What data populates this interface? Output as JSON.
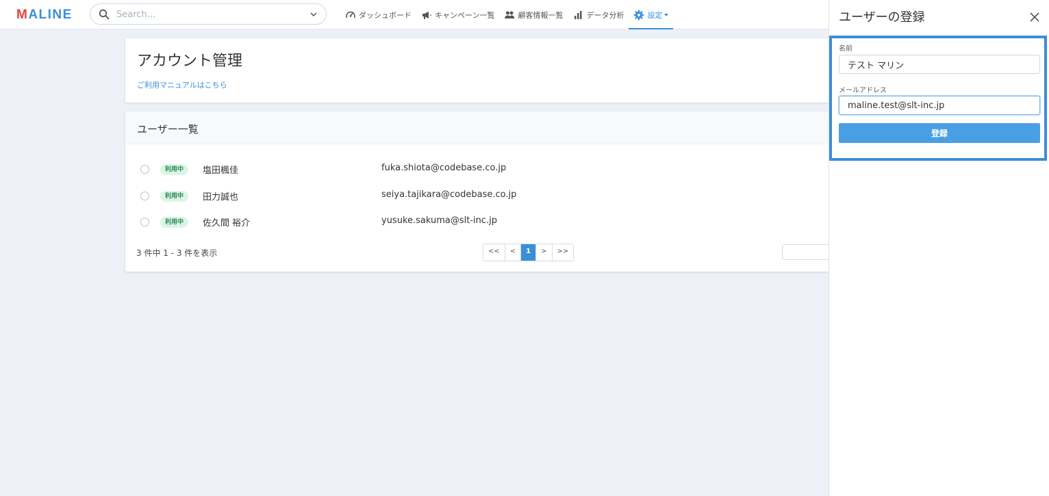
{
  "app": {
    "logo_prefix": "M",
    "logo_rest": "ALINE"
  },
  "search": {
    "placeholder": "Search..."
  },
  "nav": {
    "items": [
      {
        "label": "ダッシュボード",
        "icon": "gauge-icon"
      },
      {
        "label": "キャンペーン一覧",
        "icon": "megaphone-icon"
      },
      {
        "label": "顧客情報一覧",
        "icon": "users-icon"
      },
      {
        "label": "データ分析",
        "icon": "bar-chart-icon"
      },
      {
        "label": "設定",
        "icon": "gear-icon",
        "active": true
      }
    ]
  },
  "page": {
    "title": "アカウント管理",
    "manual_link": "ご利用マニュアルはこちら"
  },
  "user_list": {
    "title": "ユーザー一覧",
    "status_label": "利用中",
    "rows": [
      {
        "name": "塩田楓佳",
        "email": "fuka.shiota@codebase.co.jp",
        "status": "利用中"
      },
      {
        "name": "田力誠也",
        "email": "seiya.tajikara@codebase.co.jp",
        "status": "利用中"
      },
      {
        "name": "佐久間 裕介",
        "email": "yusuke.sakuma@slt-inc.jp",
        "status": "利用中"
      }
    ],
    "count_text": "3 件中 1 - 3 件を表示",
    "pagination": {
      "first": "<<",
      "prev": "<",
      "current": "1",
      "next": ">",
      "last": ">>"
    }
  },
  "panel": {
    "title": "ユーザーの登録",
    "name_label": "名前",
    "name_value": "テスト マリン",
    "email_label": "メールアドレス",
    "email_value": "maline.test@slt-inc.jp",
    "submit_label": "登録"
  },
  "colors": {
    "accent": "#3a8fd9",
    "badge_bg": "#dcf4e6",
    "badge_text": "#2a8a55",
    "highlight": "#3a8fd9"
  }
}
